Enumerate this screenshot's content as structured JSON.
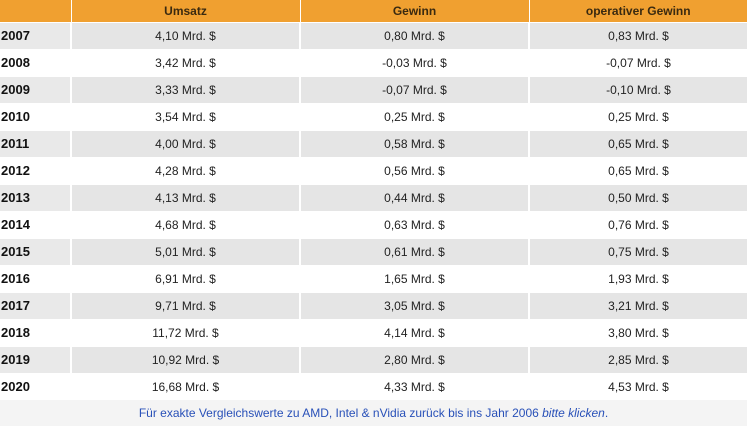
{
  "table": {
    "headers": [
      "",
      "Umsatz",
      "Gewinn",
      "operativer Gewinn"
    ],
    "rows": [
      {
        "year": "2007",
        "revenue": "4,10 Mrd. $",
        "profit": "0,80 Mrd. $",
        "operating_profit": "0,83 Mrd. $"
      },
      {
        "year": "2008",
        "revenue": "3,42 Mrd. $",
        "profit": "-0,03 Mrd. $",
        "operating_profit": "-0,07 Mrd. $"
      },
      {
        "year": "2009",
        "revenue": "3,33 Mrd. $",
        "profit": "-0,07 Mrd. $",
        "operating_profit": "-0,10 Mrd. $"
      },
      {
        "year": "2010",
        "revenue": "3,54 Mrd. $",
        "profit": "0,25 Mrd. $",
        "operating_profit": "0,25 Mrd. $"
      },
      {
        "year": "2011",
        "revenue": "4,00 Mrd. $",
        "profit": "0,58 Mrd. $",
        "operating_profit": "0,65 Mrd. $"
      },
      {
        "year": "2012",
        "revenue": "4,28 Mrd. $",
        "profit": "0,56 Mrd. $",
        "operating_profit": "0,65 Mrd. $"
      },
      {
        "year": "2013",
        "revenue": "4,13 Mrd. $",
        "profit": "0,44 Mrd. $",
        "operating_profit": "0,50 Mrd. $"
      },
      {
        "year": "2014",
        "revenue": "4,68 Mrd. $",
        "profit": "0,63 Mrd. $",
        "operating_profit": "0,76 Mrd. $"
      },
      {
        "year": "2015",
        "revenue": "5,01 Mrd. $",
        "profit": "0,61 Mrd. $",
        "operating_profit": "0,75 Mrd. $"
      },
      {
        "year": "2016",
        "revenue": "6,91 Mrd. $",
        "profit": "1,65 Mrd. $",
        "operating_profit": "1,93 Mrd. $"
      },
      {
        "year": "2017",
        "revenue": "9,71 Mrd. $",
        "profit": "3,05 Mrd. $",
        "operating_profit": "3,21 Mrd. $"
      },
      {
        "year": "2018",
        "revenue": "11,72 Mrd. $",
        "profit": "4,14 Mrd. $",
        "operating_profit": "3,80 Mrd. $"
      },
      {
        "year": "2019",
        "revenue": "10,92 Mrd. $",
        "profit": "2,80 Mrd. $",
        "operating_profit": "2,85 Mrd. $"
      },
      {
        "year": "2020",
        "revenue": "16,68 Mrd. $",
        "profit": "4,33 Mrd. $",
        "operating_profit": "4,53 Mrd. $"
      }
    ]
  },
  "footer": {
    "text": "Für exakte Vergleichswerte zu AMD, Intel & nVidia zurück bis ins Jahr 2006 ",
    "link_text": "bitte klicken",
    "suffix": "."
  },
  "colors": {
    "header_bg": "#f0a030",
    "row_alt_bg": "#e5e5e5",
    "footer_link": "#2850b8"
  }
}
